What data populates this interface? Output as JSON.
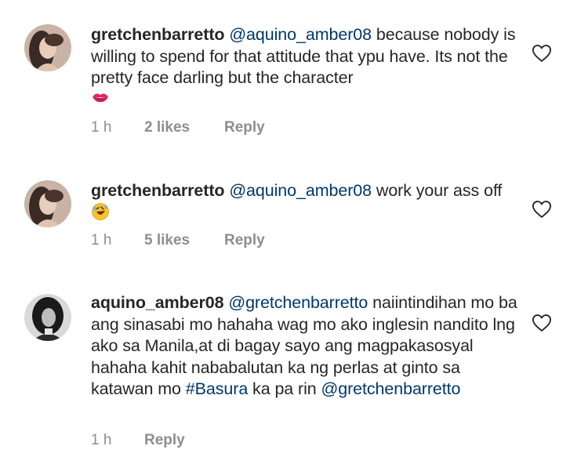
{
  "comments": [
    {
      "username": "gretchenbarretto",
      "mention": "@aquino_amber08",
      "text": " because nobody is willing to spend for that attitude that ypu have. Its not the pretty face darling but the character",
      "emoji": "kiss-mark-icon",
      "time": "1 h",
      "likes": "2 likes",
      "reply": "Reply"
    },
    {
      "username": "gretchenbarretto",
      "mention": "@aquino_amber08",
      "text": " work your ass off",
      "emoji": "rolling-on-floor-laughing-icon",
      "time": "1 h",
      "likes": "5 likes",
      "reply": "Reply"
    },
    {
      "username": "aquino_amber08",
      "mention": "@gretchenbarretto",
      "text_a": " naiintindihan mo ba ang sinasabi mo hahaha wag mo ako inglesin nandito lng ako sa Manila,at di bagay sayo ang  magpakasosyal hahaha kahit nababalutan ka ng perlas at ginto sa katawan mo ",
      "hashtag": "#Basura",
      "text_b": " ka pa rin",
      "mention_end": "@gretchenbarretto",
      "time": "1 h",
      "reply": "Reply"
    }
  ],
  "colors": {
    "text": "#262626",
    "link": "#00376b",
    "meta": "#8e8e8e",
    "background": "#ffffff"
  }
}
